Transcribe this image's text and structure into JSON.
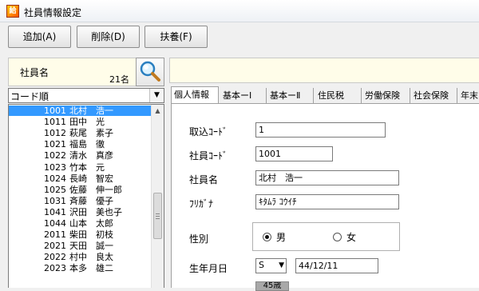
{
  "window": {
    "title": "社員情報設定"
  },
  "toolbar": {
    "add_label": "追加(A)",
    "delete_label": "削除(D)",
    "dependents_label": "扶養(F)"
  },
  "left_panel": {
    "header_label": "社員名",
    "count": "21名",
    "sort_value": "コード順"
  },
  "employees": [
    {
      "code": "1001",
      "name": "北村　浩一",
      "selected": true
    },
    {
      "code": "1011",
      "name": "田中　光"
    },
    {
      "code": "1012",
      "name": "萩尾　素子"
    },
    {
      "code": "1021",
      "name": "福島　徹"
    },
    {
      "code": "1022",
      "name": "清水　真彦"
    },
    {
      "code": "1023",
      "name": "竹本　元"
    },
    {
      "code": "1024",
      "name": "長崎　智宏"
    },
    {
      "code": "1025",
      "name": "佐藤　伸一郎"
    },
    {
      "code": "1031",
      "name": "斉藤　優子"
    },
    {
      "code": "1041",
      "name": "沢田　美也子"
    },
    {
      "code": "1044",
      "name": "山本　太郎"
    },
    {
      "code": "2011",
      "name": "柴田　初枝"
    },
    {
      "code": "2021",
      "name": "天田　誠一"
    },
    {
      "code": "2022",
      "name": "村中　良太"
    },
    {
      "code": "2023",
      "name": "本多　雄二"
    }
  ],
  "tabs": [
    {
      "label": "個人情報",
      "active": true
    },
    {
      "label": "基本ーⅠ"
    },
    {
      "label": "基本ーⅡ"
    },
    {
      "label": "住民税"
    },
    {
      "label": "労働保険"
    },
    {
      "label": "社会保険"
    },
    {
      "label": "年末"
    }
  ],
  "form": {
    "intake_code_label": "取込ｺｰﾄﾞ",
    "intake_code_value": "1",
    "employee_code_label": "社員ｺｰﾄﾞ",
    "employee_code_value": "1001",
    "employee_name_label": "社員名",
    "employee_name_value": "北村　浩一",
    "kana_label": "ﾌﾘｶﾞﾅ",
    "kana_value": "ｷﾀﾑﾗ ｺｳｲﾁ",
    "gender_label": "性別",
    "gender_male": "男",
    "gender_female": "女",
    "gender_selected": "male",
    "birthdate_label": "生年月日",
    "era_value": "S",
    "birthdate_value": "44/12/11",
    "age_value": "45歳"
  },
  "colors": {
    "selection": "#3399ff",
    "header_bg": "#fffde9"
  }
}
